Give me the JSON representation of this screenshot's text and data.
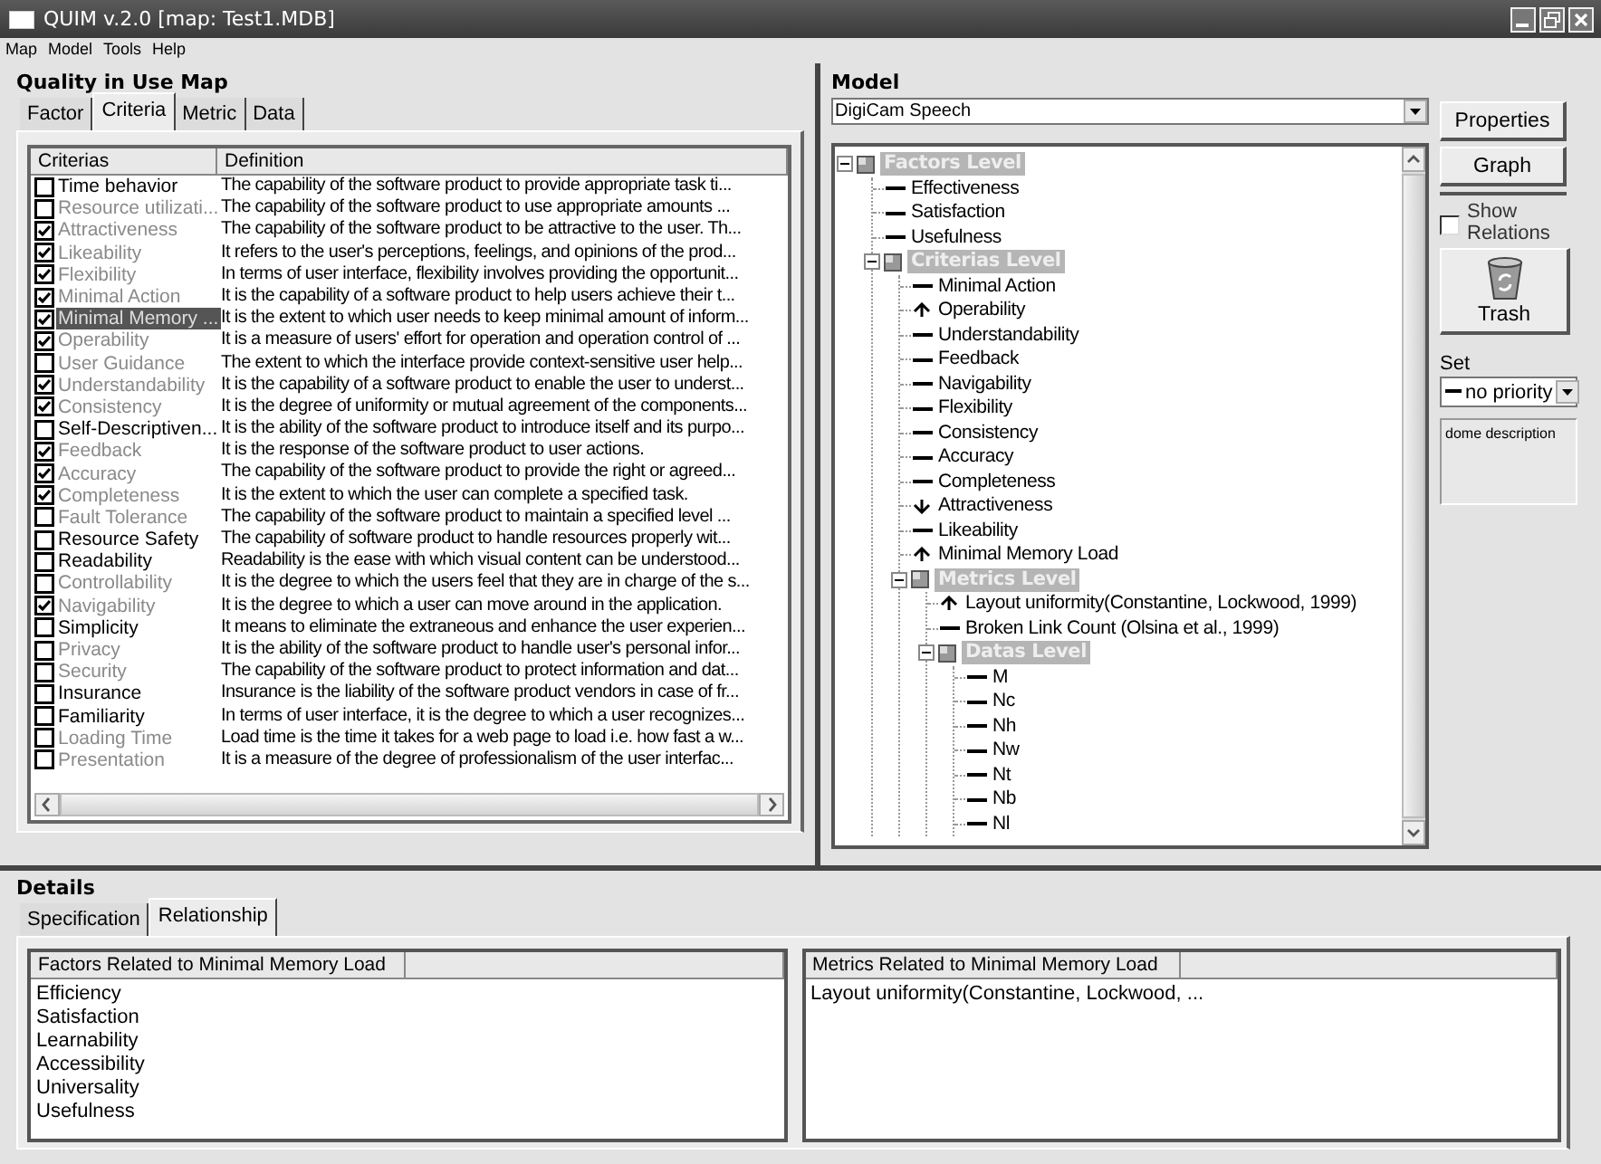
{
  "window": {
    "title": "QUIM v.2.0 [map: Test1.MDB]"
  },
  "menu": [
    "Map",
    "Model",
    "Tools",
    "Help"
  ],
  "map_panel": {
    "heading": "Quality in Use Map",
    "tabs": [
      {
        "label": "Factor",
        "selected": false
      },
      {
        "label": "Criteria",
        "selected": true
      },
      {
        "label": "Metric",
        "selected": false
      },
      {
        "label": "Data",
        "selected": false
      }
    ],
    "columns": [
      "Criterias",
      "Definition"
    ],
    "rows": [
      {
        "name": "Time behavior",
        "definition": "The capability of the software product to provide appropriate task ti...",
        "checked": false,
        "dimmed": false,
        "selected": false
      },
      {
        "name": "Resource utilizati...",
        "definition": "The capability of the software product to use appropriate amounts ...",
        "checked": false,
        "dimmed": true,
        "selected": false
      },
      {
        "name": "Attractiveness",
        "definition": "The capability of the software product to be attractive to the user. Th...",
        "checked": true,
        "dimmed": true,
        "selected": false
      },
      {
        "name": "Likeability",
        "definition": "It refers to the user's perceptions, feelings, and opinions of the prod...",
        "checked": true,
        "dimmed": true,
        "selected": false
      },
      {
        "name": "Flexibility",
        "definition": "In terms of user interface, flexibility involves providing the opportunit...",
        "checked": true,
        "dimmed": true,
        "selected": false
      },
      {
        "name": "Minimal Action",
        "definition": "It is the capability of a software product to help users achieve their t...",
        "checked": true,
        "dimmed": true,
        "selected": false
      },
      {
        "name": "Minimal Memory ...",
        "definition": "It is the extent to which user needs to keep minimal amount of inform...",
        "checked": true,
        "dimmed": true,
        "selected": true
      },
      {
        "name": "Operability",
        "definition": "It is a measure of users' effort for operation and operation control of ...",
        "checked": true,
        "dimmed": true,
        "selected": false
      },
      {
        "name": "User Guidance",
        "definition": "The extent to which the interface provide context-sensitive user help...",
        "checked": false,
        "dimmed": true,
        "selected": false
      },
      {
        "name": "Understandability",
        "definition": "It is the capability of a software product to enable the user to underst...",
        "checked": true,
        "dimmed": true,
        "selected": false
      },
      {
        "name": "Consistency",
        "definition": "It is the degree of uniformity or mutual agreement of the components...",
        "checked": true,
        "dimmed": true,
        "selected": false
      },
      {
        "name": "Self-Descriptiven...",
        "definition": "It is the ability of the software product to introduce itself and its purpo...",
        "checked": false,
        "dimmed": false,
        "selected": false
      },
      {
        "name": "Feedback",
        "definition": "It is the response of the software product to user actions.",
        "checked": true,
        "dimmed": true,
        "selected": false
      },
      {
        "name": "Accuracy",
        "definition": "The capability of the software product to provide the right or agreed...",
        "checked": true,
        "dimmed": true,
        "selected": false
      },
      {
        "name": "Completeness",
        "definition": "It is the extent to which the user can complete a specified task.",
        "checked": true,
        "dimmed": true,
        "selected": false
      },
      {
        "name": "Fault Tolerance",
        "definition": "The capability of the software product to maintain a specified level ...",
        "checked": false,
        "dimmed": true,
        "selected": false
      },
      {
        "name": "Resource Safety",
        "definition": "The capability of software product to handle resources properly wit...",
        "checked": false,
        "dimmed": false,
        "selected": false
      },
      {
        "name": "Readability",
        "definition": "Readability is the ease with which visual content can be understood...",
        "checked": false,
        "dimmed": false,
        "selected": false
      },
      {
        "name": "Controllability",
        "definition": "It is the degree to which the users feel that they are in charge of the s...",
        "checked": false,
        "dimmed": true,
        "selected": false
      },
      {
        "name": "Navigability",
        "definition": "It is the degree to which a user can move around in the application.",
        "checked": true,
        "dimmed": true,
        "selected": false
      },
      {
        "name": "Simplicity",
        "definition": "It means to eliminate the extraneous and enhance the user experien...",
        "checked": false,
        "dimmed": false,
        "selected": false
      },
      {
        "name": "Privacy",
        "definition": "It is the ability of the software product to handle user's personal infor...",
        "checked": false,
        "dimmed": true,
        "selected": false
      },
      {
        "name": "Security",
        "definition": "The capability of the software product to protect information and dat...",
        "checked": false,
        "dimmed": true,
        "selected": false
      },
      {
        "name": "Insurance",
        "definition": "Insurance is the liability of the software product vendors in case of fr...",
        "checked": false,
        "dimmed": false,
        "selected": false
      },
      {
        "name": "Familiarity",
        "definition": "In terms of user interface, it is the degree to which a user recognizes...",
        "checked": false,
        "dimmed": false,
        "selected": false
      },
      {
        "name": "Loading Time",
        "definition": "Load time is the time it takes for a web page to load i.e. how fast a w...",
        "checked": false,
        "dimmed": true,
        "selected": false
      },
      {
        "name": "Presentation",
        "definition": "It is a measure of the degree of professionalism of the user interfac...",
        "checked": false,
        "dimmed": true,
        "selected": false
      }
    ]
  },
  "model_panel": {
    "heading": "Model",
    "model_select": "DigiCam Speech",
    "tree": [
      {
        "label": "Factors Level",
        "kind": "level",
        "expanded": true,
        "children": [
          {
            "label": "Effectiveness",
            "kind": "dash"
          },
          {
            "label": "Satisfaction",
            "kind": "dash"
          },
          {
            "label": "Usefulness",
            "kind": "dash"
          },
          {
            "label": "Criterias Level",
            "kind": "level",
            "expanded": true,
            "children": [
              {
                "label": "Minimal Action",
                "kind": "dash"
              },
              {
                "label": "Operability",
                "kind": "up"
              },
              {
                "label": "Understandability",
                "kind": "dash"
              },
              {
                "label": "Feedback",
                "kind": "dash"
              },
              {
                "label": "Navigability",
                "kind": "dash"
              },
              {
                "label": "Flexibility",
                "kind": "dash"
              },
              {
                "label": "Consistency",
                "kind": "dash"
              },
              {
                "label": "Accuracy",
                "kind": "dash"
              },
              {
                "label": "Completeness",
                "kind": "dash"
              },
              {
                "label": "Attractiveness",
                "kind": "down"
              },
              {
                "label": "Likeability",
                "kind": "dash"
              },
              {
                "label": "Minimal Memory Load",
                "kind": "up"
              },
              {
                "label": "Metrics Level",
                "kind": "level",
                "expanded": true,
                "children": [
                  {
                    "label": "Layout uniformity(Constantine, Lockwood, 1999)",
                    "kind": "up"
                  },
                  {
                    "label": "Broken Link Count  (Olsina et al., 1999)",
                    "kind": "dash"
                  },
                  {
                    "label": "Datas Level",
                    "kind": "level",
                    "expanded": true,
                    "children": [
                      {
                        "label": "M",
                        "kind": "dash"
                      },
                      {
                        "label": "Nc",
                        "kind": "dash"
                      },
                      {
                        "label": "Nh",
                        "kind": "dash"
                      },
                      {
                        "label": "Nw",
                        "kind": "dash"
                      },
                      {
                        "label": "Nt",
                        "kind": "dash"
                      },
                      {
                        "label": "Nb",
                        "kind": "dash"
                      },
                      {
                        "label": "Nl",
                        "kind": "dash"
                      }
                    ]
                  }
                ]
              }
            ]
          }
        ]
      }
    ],
    "buttons": {
      "properties": "Properties",
      "graph": "Graph",
      "trash": "Trash"
    },
    "show_relations": {
      "label": "Show Relations",
      "checked": false
    },
    "set": {
      "label": "Set",
      "value": "no priority"
    },
    "description": "dome description"
  },
  "details": {
    "heading": "Details",
    "tabs": [
      {
        "label": "Specification",
        "selected": false
      },
      {
        "label": "Relationship",
        "selected": true
      }
    ],
    "factors": {
      "column": "Factors Related to Minimal Memory Load",
      "items": [
        "Efficiency",
        "Satisfaction",
        "Learnability",
        "Accessibility",
        "Universality",
        "Usefulness"
      ]
    },
    "metrics": {
      "column": "Metrics Related to Minimal Memory Load",
      "items": [
        "Layout uniformity(Constantine, Lockwood, ..."
      ]
    }
  }
}
